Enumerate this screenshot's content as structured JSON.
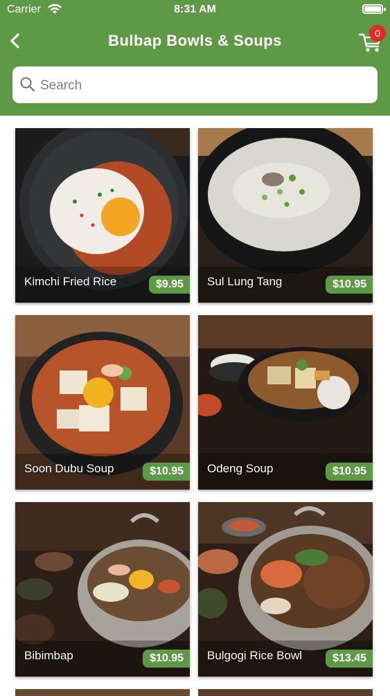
{
  "status_bar": {
    "carrier": "Carrier",
    "time": "8:31 AM"
  },
  "header": {
    "title": "Bulbap Bowls & Soups",
    "cart_count": "0"
  },
  "search": {
    "placeholder": "Search"
  },
  "colors": {
    "primary": "#5e9a45",
    "badge": "#e32a25"
  },
  "menu_items": [
    {
      "name": "Kimchi Fried Rice",
      "price": "$9.95"
    },
    {
      "name": "Sul Lung Tang",
      "price": "$10.95"
    },
    {
      "name": "Soon Dubu Soup",
      "price": "$10.95"
    },
    {
      "name": "Odeng Soup",
      "price": "$10.95"
    },
    {
      "name": "Bibimbap",
      "price": "$10.95"
    },
    {
      "name": "Bulgogi Rice Bowl",
      "price": "$13.45"
    }
  ]
}
